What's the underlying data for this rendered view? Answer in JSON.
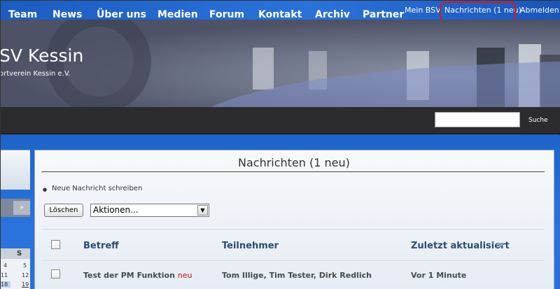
{
  "topbar": {
    "mein_bsv": "Mein BSV",
    "nachrichten": "Nachrichten (1 neu)",
    "abmelden": "Abmelden"
  },
  "header": {
    "title": "SV Kessin",
    "subtitle": "ortverein Kessin e.V."
  },
  "nav": {
    "items": [
      "Team",
      "News",
      "Über uns",
      "Medien",
      "Forum",
      "Kontakt",
      "Archiv",
      "Partner"
    ],
    "search_label": "Suche",
    "search_value": ""
  },
  "sidebar": {
    "calendar": {
      "header_day": "S",
      "rows": [
        [
          "4",
          "5"
        ],
        [
          "11",
          "12"
        ],
        [
          "18",
          "19"
        ]
      ]
    }
  },
  "main": {
    "title": "Nachrichten (1 neu)",
    "new_message_link": "Neue Nachricht schreiben",
    "delete_button": "Löschen",
    "actions_select": "Aktionen...",
    "columns": [
      "Betreff",
      "Teilnehmer",
      "Zuletzt aktualisiert"
    ],
    "rows": [
      {
        "subject": "Test der PM Funktion",
        "badge": "neu",
        "participants": "Tom Illige, Tim Tester, Dirk Redlich",
        "updated": "Vor 1 Minute"
      }
    ]
  },
  "colors": {
    "topbar": "#1f63c6",
    "nav_bg": "#2c2c2e",
    "highlight": "#d21a1a",
    "column_header": "#2e4b74",
    "new_badge": "#c01818"
  }
}
